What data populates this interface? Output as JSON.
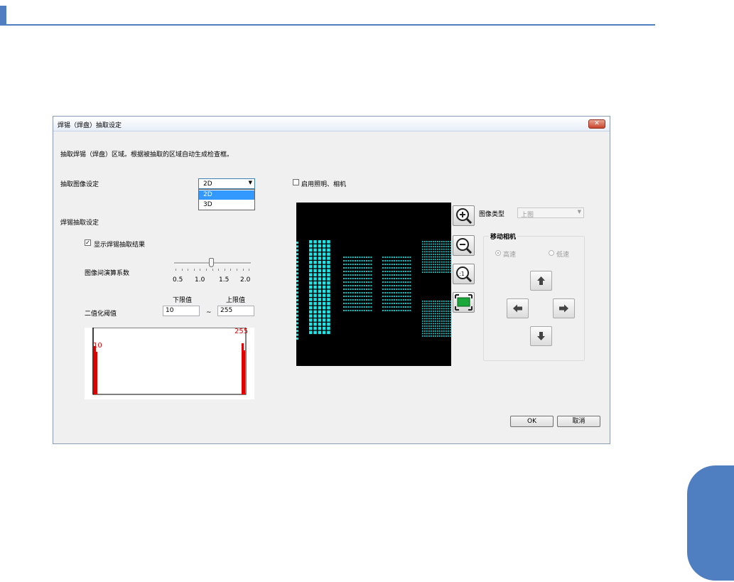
{
  "window": {
    "title": "焊锡（焊盘）抽取设定",
    "close_glyph": "✕",
    "description": "抽取焊锡（焊盘）区域。根据被抽取的区域自动生成检查框。"
  },
  "extract_image": {
    "label": "抽取图像设定",
    "selected": "2D",
    "options": [
      "2D",
      "3D"
    ],
    "arrow_icon": "caret-down-icon"
  },
  "solder_settings": {
    "label": "焊锡抽取设定",
    "show_result_label": "显示焊锡抽取结果",
    "show_result_checked": true,
    "coef_label": "图像间演算系数",
    "coef_ticks": [
      "0.5",
      "1.0",
      "1.5",
      "2.0"
    ],
    "coef_value": 1.2,
    "coef_range": [
      0.5,
      2.0
    ],
    "lower_label": "下限值",
    "upper_label": "上限值",
    "threshold_label": "二值化阈值",
    "lower_value": "10",
    "tilde": "~",
    "upper_value": "255"
  },
  "histogram": {
    "low_marker": "10",
    "high_marker": "255",
    "color": "#e00000"
  },
  "lighting": {
    "label": "启用照明、相机",
    "checked": false
  },
  "tools": {
    "zoom_in_icon": "zoom-in-icon",
    "zoom_out_icon": "zoom-out-icon",
    "zoom_actual_icon": "zoom-actual-icon",
    "fit_icon": "fit-screen-icon"
  },
  "image_type": {
    "label": "图像类型",
    "value": "上图"
  },
  "move_camera": {
    "legend": "移动相机",
    "high_speed": "高速",
    "low_speed": "低速",
    "selected": "高速"
  },
  "buttons": {
    "ok": "OK",
    "cancel": "取消"
  },
  "colors": {
    "accent": "#4f7fc0",
    "pad_cyan": "#1fe6e6",
    "dropdown_highlight": "#3399ff"
  }
}
